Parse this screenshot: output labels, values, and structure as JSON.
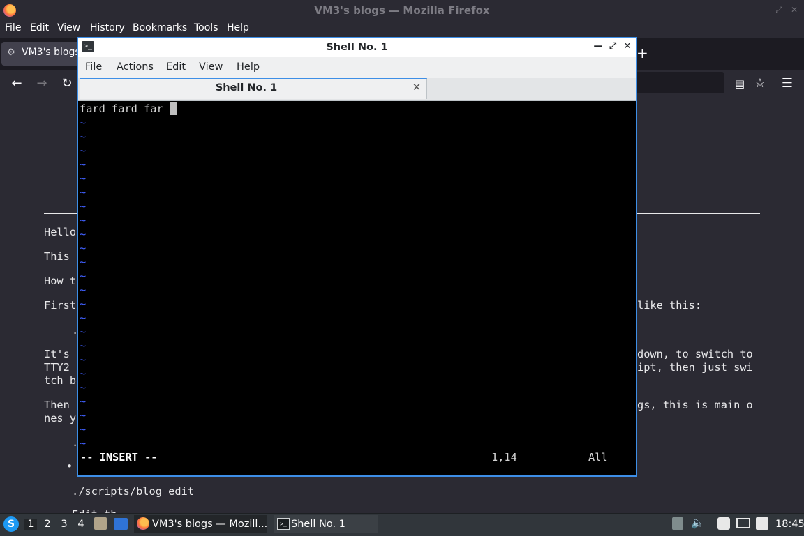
{
  "firefox": {
    "window_title": "VM3's blogs — Mozilla Firefox",
    "menu": [
      "File",
      "Edit",
      "View",
      "History",
      "Bookmarks",
      "Tools",
      "Help"
    ],
    "tab_label": "VM3's blogs",
    "new_tab": "+",
    "page_lines": {
      "l1": "Hello",
      "l2": "This",
      "l3": "How t",
      "l4a": "First",
      "l4b": "like this:",
      "l5": ".",
      "l6a": "It's",
      "l6b": "down, to switch to",
      "l7a": "TTY2",
      "l7b": "ipt, then just swi",
      "l8": "tch b",
      "l9a": "Then",
      "l9b": "gs, this is main o",
      "l10": "nes y",
      "l11": ".",
      "bullet": "•",
      "l12": "./scripts/blog edit",
      "l13": "Edit th"
    }
  },
  "shell": {
    "title": "Shell No. 1",
    "menu": [
      "File",
      "Actions",
      "Edit",
      "View",
      "Help"
    ],
    "tab_label": "Shell No. 1",
    "buffer_text": "fard fard far",
    "tilde": "~",
    "mode": "-- INSERT --",
    "position": "1,14",
    "range": "All"
  },
  "taskbar": {
    "workspaces": [
      "1",
      "2",
      "3",
      "4"
    ],
    "tasks": [
      "VM3's blogs — Mozill...",
      "Shell No. 1"
    ],
    "clock": "18:45"
  }
}
